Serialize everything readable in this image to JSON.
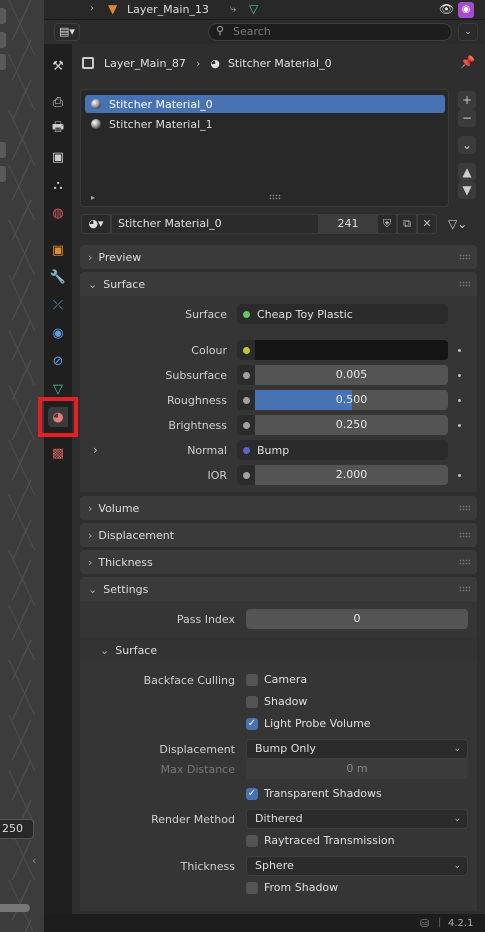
{
  "outliner": {
    "layer_name": "Layer_Main_13"
  },
  "header": {
    "search_placeholder": "Search"
  },
  "breadcrumb": {
    "object": "Layer_Main_87",
    "material": "Stitcher Material_0"
  },
  "material_slots": [
    {
      "name": "Stitcher Material_0",
      "selected": true
    },
    {
      "name": "Stitcher Material_1",
      "selected": false
    }
  ],
  "datablock": {
    "name": "Stitcher Material_0",
    "users": "241"
  },
  "sections": {
    "preview": "Preview",
    "surface": "Surface",
    "volume": "Volume",
    "displacement": "Displacement",
    "thickness": "Thickness",
    "settings": "Settings",
    "settings_surface": "Surface"
  },
  "surface": {
    "surface_label": "Surface",
    "surface_value": "Cheap Toy Plastic",
    "colour_label": "Colour",
    "subsurface_label": "Subsurface",
    "subsurface_value": "0.005",
    "roughness_label": "Roughness",
    "roughness_value": "0.500",
    "roughness_fraction": 0.5,
    "brightness_label": "Brightness",
    "brightness_value": "0.250",
    "normal_label": "Normal",
    "normal_value": "Bump",
    "ior_label": "IOR",
    "ior_value": "2.000"
  },
  "settings": {
    "pass_index_label": "Pass Index",
    "pass_index_value": "0",
    "backface_culling_label": "Backface Culling",
    "camera_label": "Camera",
    "camera_checked": false,
    "shadow_label": "Shadow",
    "shadow_checked": false,
    "light_probe_label": "Light Probe Volume",
    "light_probe_checked": true,
    "displacement_label": "Displacement",
    "displacement_value": "Bump Only",
    "max_distance_label": "Max Distance",
    "max_distance_value": "0 m",
    "transparent_shadows_label": "Transparent Shadows",
    "transparent_shadows_checked": true,
    "render_method_label": "Render Method",
    "render_method_value": "Dithered",
    "raytraced_label": "Raytraced Transmission",
    "raytraced_checked": false,
    "thickness_label": "Thickness",
    "thickness_value": "Sphere",
    "from_shadow_label": "From Shadow",
    "from_shadow_checked": false
  },
  "viewport": {
    "frame_value": "250"
  },
  "status": {
    "version": "4.2.1"
  },
  "colors": {
    "accent": "#4772b3",
    "highlight_box": "#e81e25",
    "socket_shader": "#63c763",
    "socket_color": "#c7c729",
    "socket_float": "#a1a1a1",
    "socket_vector": "#6363c7"
  },
  "icons": [
    "tool-icon",
    "render-icon",
    "output-icon",
    "view-layer-icon",
    "scene-icon",
    "world-icon",
    "object-icon",
    "modifier-icon",
    "particles-icon",
    "physics-icon",
    "constraints-icon",
    "data-icon",
    "material-icon",
    "texture-icon"
  ]
}
